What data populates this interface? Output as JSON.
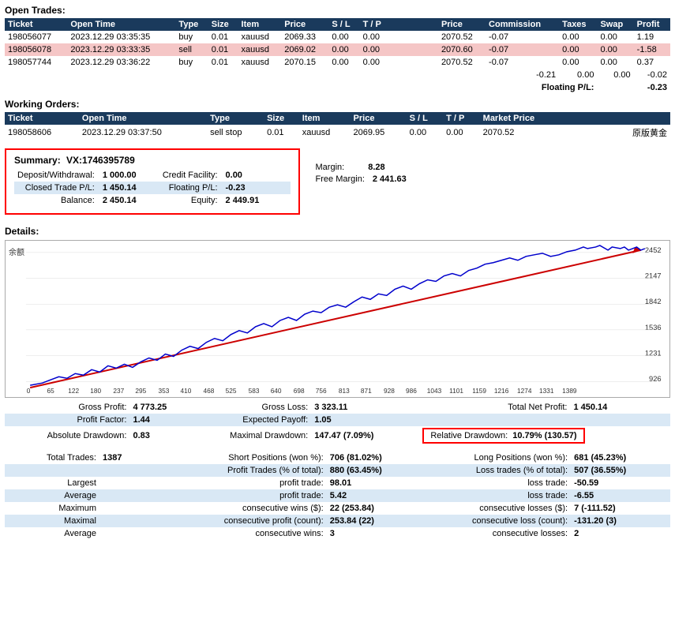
{
  "open_trades": {
    "title": "Open Trades:",
    "columns": [
      "Ticket",
      "Open Time",
      "Type",
      "Size",
      "Item",
      "Price",
      "S / L",
      "T / P",
      "",
      "Price",
      "Commission",
      "Taxes",
      "Swap",
      "Profit"
    ],
    "rows": [
      {
        "ticket": "198056077",
        "open_time": "2023.12.29 03:35:35",
        "type": "buy",
        "size": "0.01",
        "item": "xauusd",
        "price": "2069.33",
        "sl": "0.00",
        "tp": "0.00",
        "price2": "2070.52",
        "commission": "-0.07",
        "taxes": "0.00",
        "swap": "0.00",
        "profit": "1.19",
        "red": false
      },
      {
        "ticket": "198056078",
        "open_time": "2023.12.29 03:33:35",
        "type": "sell",
        "size": "0.01",
        "item": "xauusd",
        "price": "2069.02",
        "sl": "0.00",
        "tp": "0.00",
        "price2": "2070.60",
        "commission": "-0.07",
        "taxes": "0.00",
        "swap": "0.00",
        "profit": "-1.58",
        "red": true
      },
      {
        "ticket": "198057744",
        "open_time": "2023.12.29 03:36:22",
        "type": "buy",
        "size": "0.01",
        "item": "xauusd",
        "price": "2070.15",
        "sl": "0.00",
        "tp": "0.00",
        "price2": "2070.52",
        "commission": "-0.07",
        "taxes": "0.00",
        "swap": "0.00",
        "profit": "0.37",
        "red": false
      }
    ],
    "totals": {
      "commission": "-0.21",
      "taxes": "0.00",
      "swap": "0.00",
      "profit": "-0.02"
    },
    "floating": {
      "label": "Floating P/L:",
      "value": "-0.23"
    }
  },
  "working_orders": {
    "title": "Working Orders:",
    "columns": [
      "Ticket",
      "Open Time",
      "Type",
      "Size",
      "Item",
      "Price",
      "S / L",
      "T / P",
      "Market Price",
      "",
      ""
    ],
    "rows": [
      {
        "ticket": "198058606",
        "open_time": "2023.12.29 03:37:50",
        "type": "sell stop",
        "size": "0.01",
        "item": "xauusd",
        "price": "2069.95",
        "sl": "0.00",
        "tp": "0.00",
        "market_price": "2070.52",
        "note": "原版黄金"
      }
    ]
  },
  "summary": {
    "title": "Summary:",
    "vx": "VX:1746395789",
    "rows": [
      {
        "label": "Deposit/Withdrawal:",
        "value": "1 000.00",
        "label2": "Credit Facility:",
        "value2": "0.00",
        "label3": "",
        "value3": ""
      },
      {
        "label": "Closed Trade P/L:",
        "value": "1 450.14",
        "label2": "Floating P/L:",
        "value2": "-0.23",
        "label3": "Margin:",
        "value3": "8.28"
      },
      {
        "label": "Balance:",
        "value": "2 450.14",
        "label2": "Equity:",
        "value2": "2 449.91",
        "label3": "Free Margin:",
        "value3": "2 441.63"
      }
    ]
  },
  "details": {
    "title": "Details:",
    "chart": {
      "y_label": "余额",
      "x_labels": [
        "0",
        "65",
        "122",
        "180",
        "237",
        "295",
        "353",
        "410",
        "468",
        "525",
        "583",
        "640",
        "698",
        "756",
        "813",
        "871",
        "928",
        "986",
        "1043",
        "1101",
        "1159",
        "1216",
        "1274",
        "1331",
        "1389"
      ],
      "y_labels": [
        "2452",
        "2147",
        "1842",
        "1536",
        "1231",
        "926"
      ],
      "line_points": "30,185 50,178 70,170 90,165 110,160 130,152 145,158 155,150 165,155 175,148 185,145 195,140 205,148 215,142 225,138 235,145 245,135 255,130 265,125 275,128 285,120 295,115 305,118 315,110 325,108 335,112 345,105 355,100 365,98 375,102 385,95 395,90 405,88 415,85 425,88 435,82 445,80 455,75 465,78 475,70 485,65 495,68 505,62 515,58 525,55 535,52 545,48 555,45 565,42 575,40 585,38 595,35 605,32 615,28 625,25 635,22 645,25 655,20 665,18 675,16 685,18 695,15 705,12 715,15 725,10 735,8 745,12 755,8 760,10 770,8 780,12",
      "trend_start": "30,185",
      "trend_end": "775,5"
    },
    "stats": {
      "gross_profit_label": "Gross Profit:",
      "gross_profit_value": "4 773.25",
      "gross_loss_label": "Gross Loss:",
      "gross_loss_value": "3 323.11",
      "total_net_profit_label": "Total Net Profit:",
      "total_net_profit_value": "1 450.14",
      "profit_factor_label": "Profit Factor:",
      "profit_factor_value": "1.44",
      "expected_payoff_label": "Expected Payoff:",
      "expected_payoff_value": "1.05",
      "absolute_drawdown_label": "Absolute Drawdown:",
      "absolute_drawdown_value": "0.83",
      "maximal_drawdown_label": "Maximal Drawdown:",
      "maximal_drawdown_value": "147.47 (7.09%)",
      "relative_drawdown_label": "Relative Drawdown:",
      "relative_drawdown_value": "10.79% (130.57)"
    },
    "trade_stats": {
      "total_trades_label": "Total Trades:",
      "total_trades_value": "1387",
      "short_positions_label": "Short Positions (won %):",
      "short_positions_value": "706 (81.02%)",
      "long_positions_label": "Long Positions (won %):",
      "long_positions_value": "681 (45.23%)",
      "profit_trades_label": "Profit Trades (% of total):",
      "profit_trades_value": "880 (63.45%)",
      "loss_trades_label": "Loss trades (% of total):",
      "loss_trades_value": "507 (36.55%)",
      "largest_profit_label": "profit trade:",
      "largest_profit_value": "98.01",
      "largest_loss_label": "loss trade:",
      "largest_loss_value": "-50.59",
      "average_profit_label": "profit trade:",
      "average_profit_value": "5.42",
      "average_loss_label": "loss trade:",
      "average_loss_value": "-6.55",
      "maximum_consecutive_wins_label": "consecutive wins ($):",
      "maximum_consecutive_wins_value": "22 (253.84)",
      "maximum_consecutive_losses_label": "consecutive losses ($):",
      "maximum_consecutive_losses_value": "7 (-111.52)",
      "maximal_consecutive_profit_label": "consecutive profit (count):",
      "maximal_consecutive_profit_value": "253.84 (22)",
      "maximal_consecutive_loss_label": "consecutive loss (count):",
      "maximal_consecutive_loss_value": "-131.20 (3)",
      "average_consecutive_wins_label": "consecutive wins:",
      "average_consecutive_wins_value": "3",
      "average_consecutive_losses_label": "consecutive losses:",
      "average_consecutive_losses_value": "2"
    }
  }
}
